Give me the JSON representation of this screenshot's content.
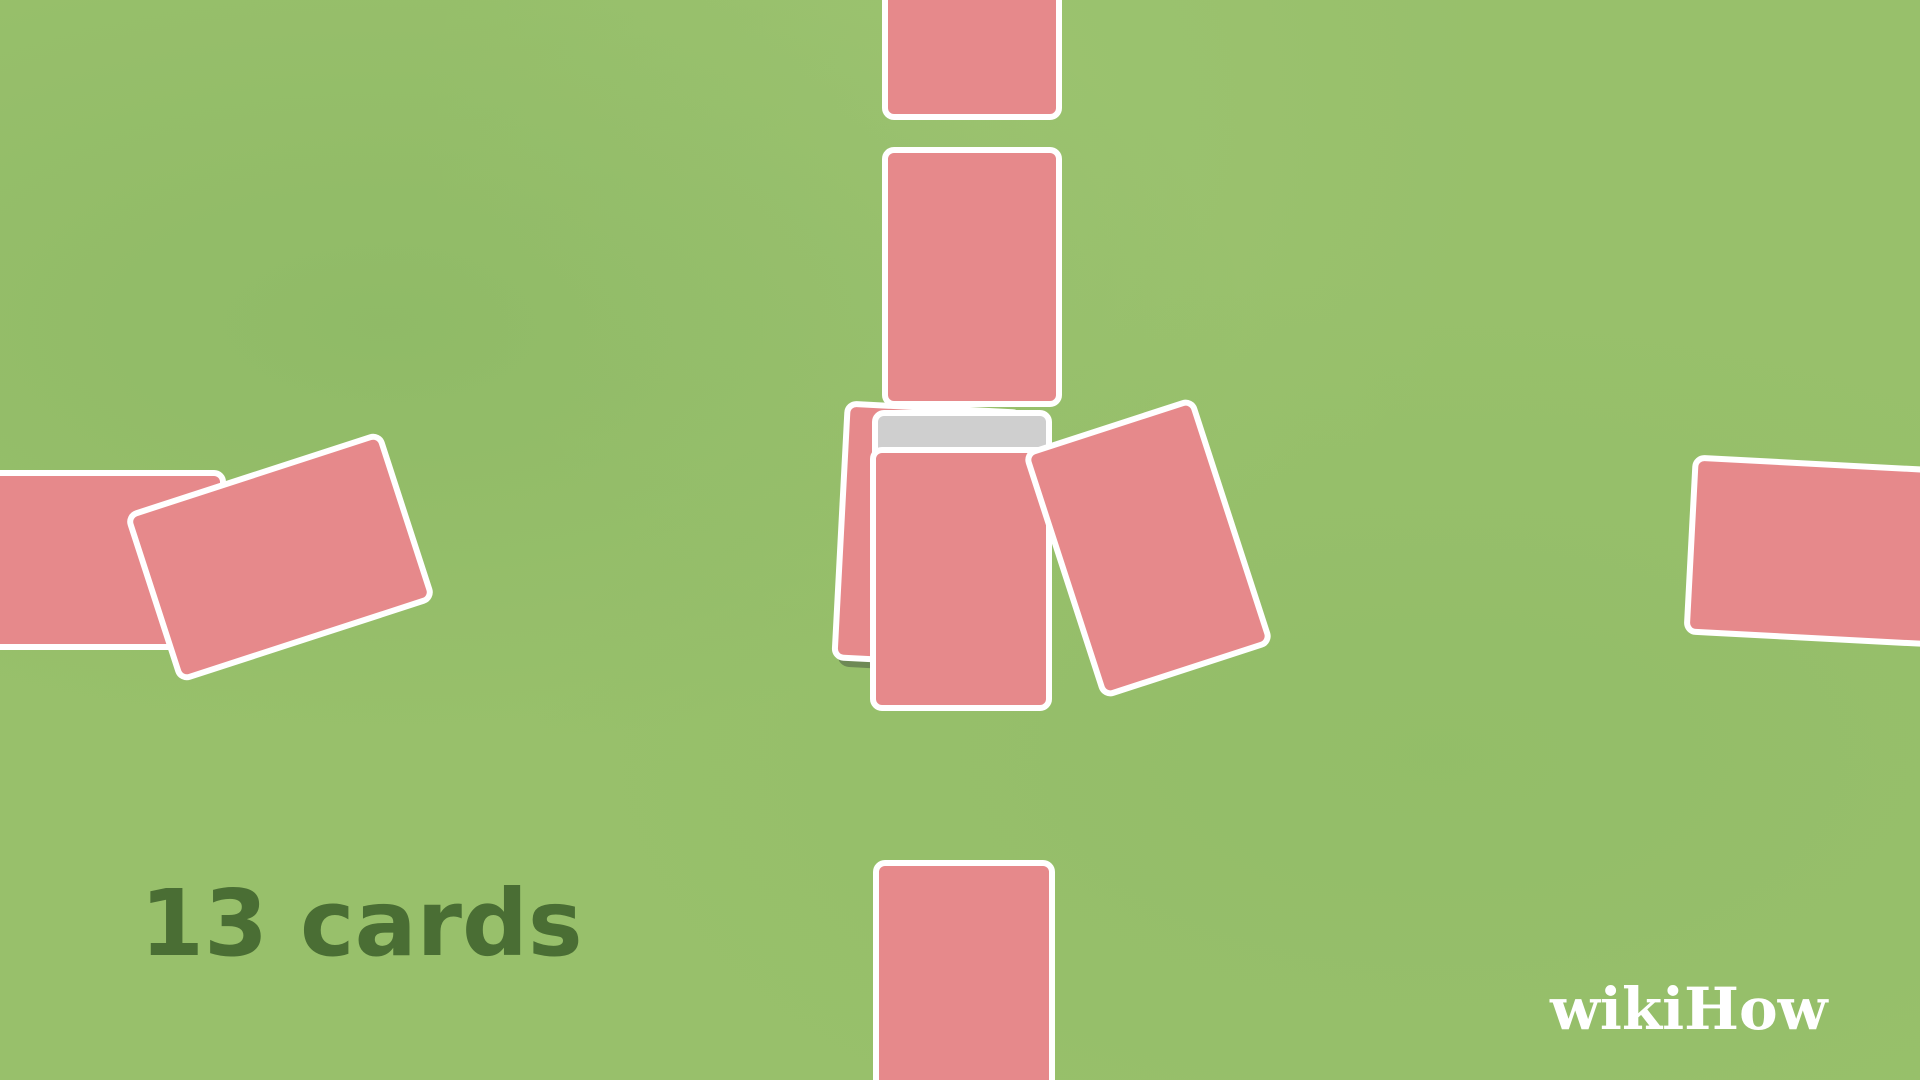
{
  "scene": {
    "card_back_color": "#e6898b",
    "card_border_color": "#ffffff",
    "table_color": "#98c06b",
    "caption": "13 cards",
    "brand": "wikiHow"
  }
}
